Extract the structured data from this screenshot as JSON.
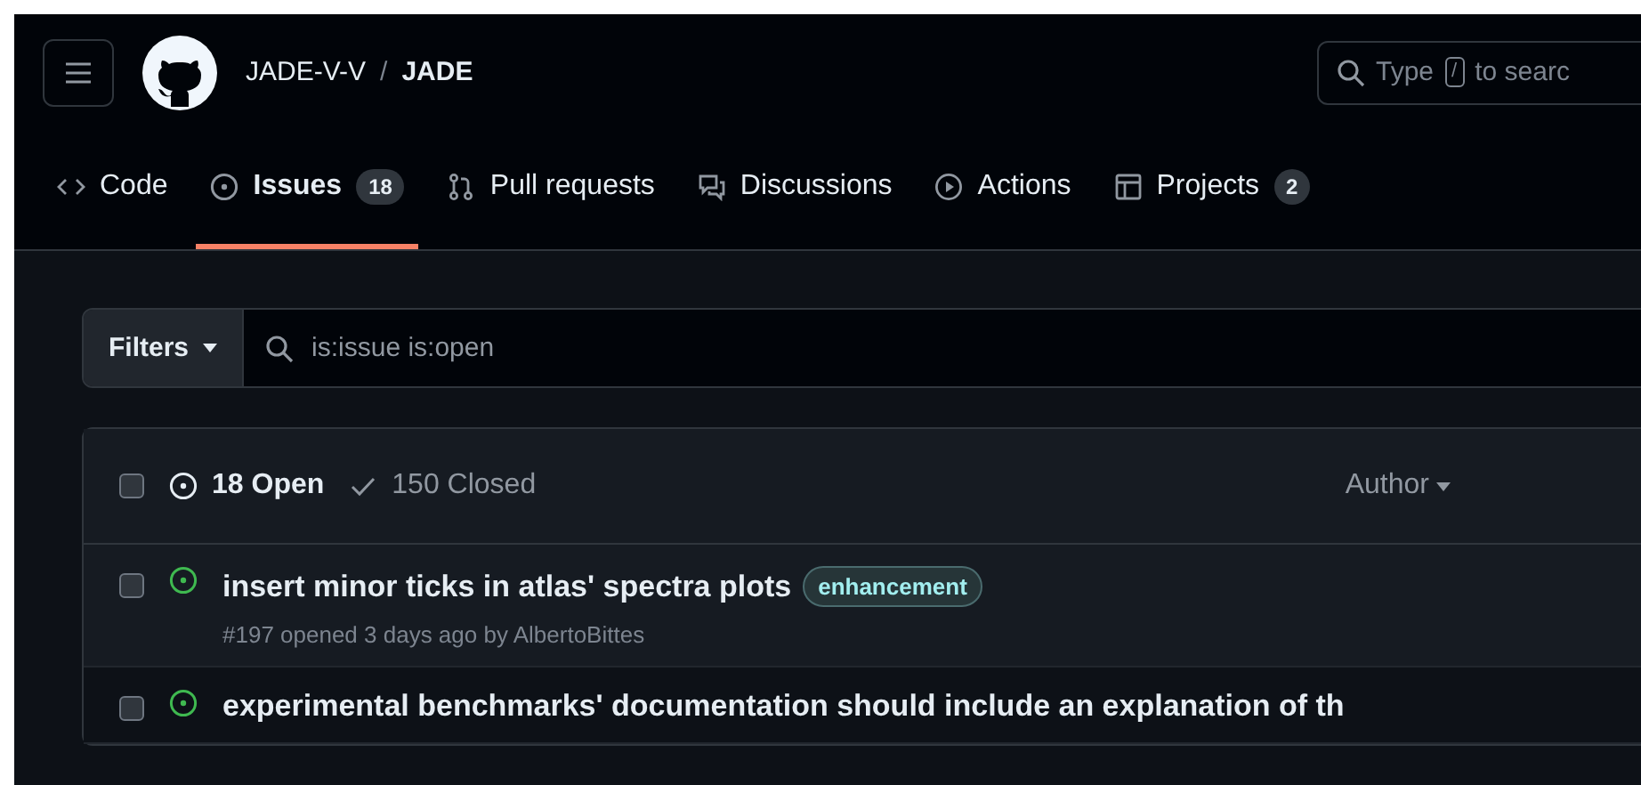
{
  "header": {
    "owner": "JADE-V-V",
    "separator": "/",
    "repo": "JADE",
    "search": {
      "placeholder_start": "Type",
      "key": "/",
      "placeholder_end": "to searc"
    }
  },
  "tabs": [
    {
      "label": "Code",
      "kind": "code",
      "selected": false
    },
    {
      "label": "Issues",
      "kind": "issue",
      "counter": "18",
      "selected": true
    },
    {
      "label": "Pull requests",
      "kind": "pr",
      "selected": false
    },
    {
      "label": "Discussions",
      "kind": "discussion",
      "selected": false
    },
    {
      "label": "Actions",
      "kind": "play",
      "selected": false
    },
    {
      "label": "Projects",
      "kind": "table",
      "counter": "2",
      "selected": false
    }
  ],
  "filter": {
    "button": "Filters",
    "query": "is:issue is:open"
  },
  "issues_header": {
    "checked": false,
    "open": "18 Open",
    "closed": "150 Closed",
    "author": "Author"
  },
  "issues": [
    {
      "title": "insert minor ticks in atlas' spectra plots",
      "labels": [
        "enhancement"
      ],
      "meta": "#197 opened 3 days ago by AlbertoBittes",
      "checked": false
    },
    {
      "title": "experimental benchmarks' documentation should include an explanation of th",
      "checked": false
    }
  ]
}
